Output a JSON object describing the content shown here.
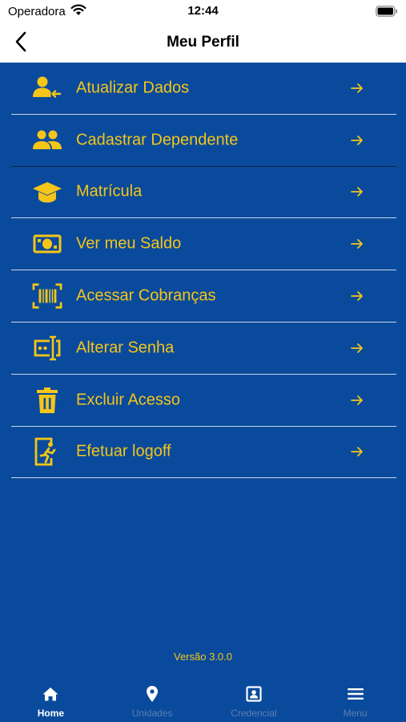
{
  "status_bar": {
    "carrier": "Operadora",
    "time": "12:44"
  },
  "nav": {
    "title": "Meu Perfil",
    "back_icon": "chevron-left-icon"
  },
  "menu": {
    "items": [
      {
        "label": "Atualizar Dados",
        "icon": "user-update-icon"
      },
      {
        "label": "Cadastrar Dependente",
        "icon": "users-icon"
      },
      {
        "label": "Matrícula",
        "icon": "graduation-cap-icon"
      },
      {
        "label": "Ver meu Saldo",
        "icon": "money-bill-icon"
      },
      {
        "label": "Acessar Cobranças",
        "icon": "barcode-scan-icon"
      },
      {
        "label": "Alterar Senha",
        "icon": "password-field-icon"
      },
      {
        "label": "Excluir Acesso",
        "icon": "trash-icon"
      },
      {
        "label": "Efetuar logoff",
        "icon": "exit-door-icon"
      }
    ],
    "arrow_icon": "arrow-right-icon"
  },
  "version": "Versão 3.0.0",
  "tabs": [
    {
      "label": "Home",
      "icon": "home-icon",
      "active": true
    },
    {
      "label": "Unidades",
      "icon": "map-pin-icon",
      "active": false
    },
    {
      "label": "Credencial",
      "icon": "id-card-icon",
      "active": false
    },
    {
      "label": "Menu",
      "icon": "hamburger-icon",
      "active": false
    }
  ],
  "colors": {
    "background": "#0a4a9c",
    "accent": "#f5c518",
    "divider": "#c9d6e8",
    "tab_inactive": "#5b7fb3",
    "tab_active": "#ffffff"
  }
}
